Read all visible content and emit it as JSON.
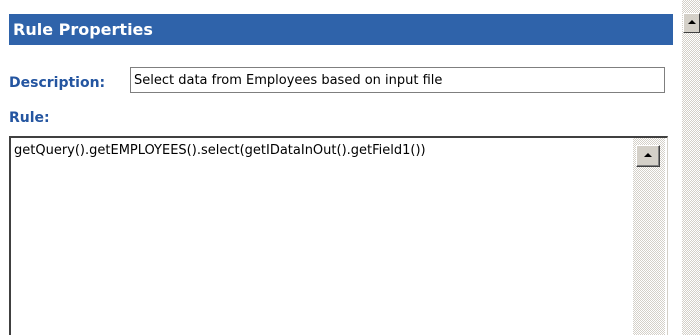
{
  "panel": {
    "title": "Rule Properties",
    "description_label": "Description:",
    "description_value": "Select data from Employees based on input file",
    "rule_label": "Rule:",
    "rule_value": "getQuery().getEMPLOYEES().select(getIDataInOut().getField1())"
  },
  "colors": {
    "title_background": "#2f63aa",
    "label_text": "#2455a0"
  },
  "icons": {
    "rule_scroll_up": "arrow-up-icon",
    "outer_scroll_up": "arrow-up-icon"
  }
}
